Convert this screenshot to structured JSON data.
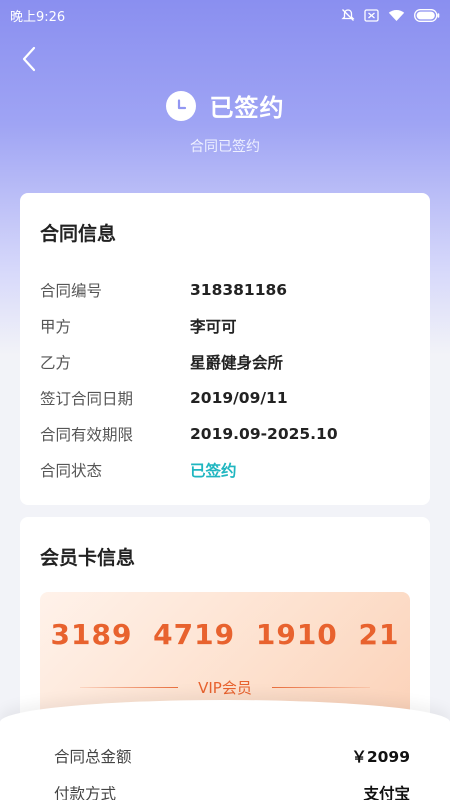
{
  "status_bar": {
    "time": "晚上9:26"
  },
  "header": {
    "title": "已签约",
    "subtitle": "合同已签约"
  },
  "contract_card": {
    "title": "合同信息",
    "rows": [
      {
        "label": "合同编号",
        "value": "318381186"
      },
      {
        "label": "甲方",
        "value": "李可可"
      },
      {
        "label": "乙方",
        "value": "星爵健身会所"
      },
      {
        "label": "签订合同日期",
        "value": "2019/09/11"
      },
      {
        "label": "合同有效期限",
        "value": "2019.09-2025.10"
      },
      {
        "label": "合同状态",
        "value": "已签约"
      }
    ],
    "status_color": "#1fb6c0"
  },
  "member_card": {
    "title": "会员卡信息",
    "card_number": "3189 4719 1910 21",
    "card_type": "VIP会员",
    "accent_color": "#e8622e"
  },
  "summary": {
    "total_label": "合同总金额",
    "total_value": "￥2099",
    "payment_label": "付款方式",
    "payment_value": "支付宝"
  },
  "icons": [
    "back-arrow-icon",
    "clock-icon",
    "mute-icon",
    "sim-icon",
    "wifi-icon",
    "battery-icon"
  ]
}
